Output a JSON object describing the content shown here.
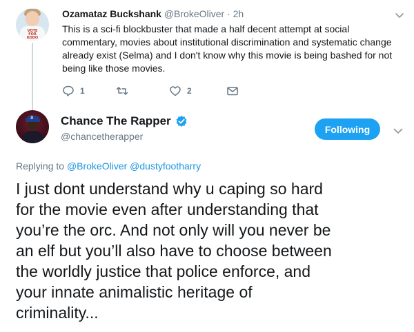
{
  "reply_tweet": {
    "display_name": "Ozamataz Buckshank",
    "handle": "@BrokeOliver",
    "separator": "·",
    "time": "2h",
    "avatar_shirt_text": "VOTE FOR KODO",
    "lines": [
      "This is a sci-fi blockbuster that made a half decent attempt at social",
      "commentary, movies about institutional discrimination and systematic change",
      "already exist (Selma) and I don't know why this movie is being bashed for not",
      "being like those movies."
    ],
    "reply_count": "1",
    "retweet_count": "",
    "like_count": "2",
    "icons": [
      "reply-icon",
      "retweet-icon",
      "like-icon",
      "message-icon",
      "chevron-down-icon"
    ]
  },
  "main_tweet": {
    "display_name": "Chance The Rapper",
    "handle": "@chancetherapper",
    "follow_label": "Following",
    "avatar_cap_number": "3",
    "replying_prefix": "Replying to",
    "mentions": [
      "@BrokeOliver",
      "@dustyfootharry"
    ],
    "lines": [
      "I just dont understand why u caping so hard",
      "for the movie even after understanding that",
      "you’re the orc. And not only will you never be",
      "an elf but you’ll also have to choose between",
      "the worldly justice that police enforce, and",
      "your innate animalistic heritage of",
      "criminality..."
    ]
  },
  "colors": {
    "accent": "#1da1f2",
    "link": "#1b95e0",
    "text": "#14171a",
    "muted": "#657786"
  }
}
